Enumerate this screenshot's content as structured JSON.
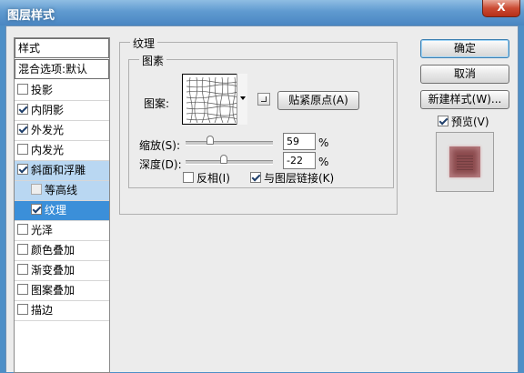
{
  "window": {
    "title": "图层样式",
    "close_label": "X"
  },
  "style_list": {
    "header": "样式",
    "blend_options": "混合选项:默认",
    "items": [
      {
        "label": "投影",
        "checked": false
      },
      {
        "label": "内阴影",
        "checked": true
      },
      {
        "label": "外发光",
        "checked": true
      },
      {
        "label": "内发光",
        "checked": false
      },
      {
        "label": "斜面和浮雕",
        "checked": true
      },
      {
        "label": "等高线",
        "checked": false
      },
      {
        "label": "纹理",
        "checked": true
      },
      {
        "label": "光泽",
        "checked": false
      },
      {
        "label": "颜色叠加",
        "checked": false
      },
      {
        "label": "渐变叠加",
        "checked": false
      },
      {
        "label": "图案叠加",
        "checked": false
      },
      {
        "label": "描边",
        "checked": false
      }
    ]
  },
  "texture_panel": {
    "group_title": "纹理",
    "subgroup_title": "图素",
    "pattern_label": "图案:",
    "snap_button": "贴紧原点(A)",
    "scale_label": "缩放(S):",
    "scale_value": "59",
    "scale_unit": "%",
    "depth_label": "深度(D):",
    "depth_value": "-22",
    "depth_unit": "%",
    "invert_label": "反相(I)",
    "invert_checked": false,
    "link_label": "与图层链接(K)",
    "link_checked": true
  },
  "actions": {
    "ok": "确定",
    "cancel": "取消",
    "new_style": "新建样式(W)...",
    "preview_label": "预览(V)",
    "preview_checked": true
  }
}
